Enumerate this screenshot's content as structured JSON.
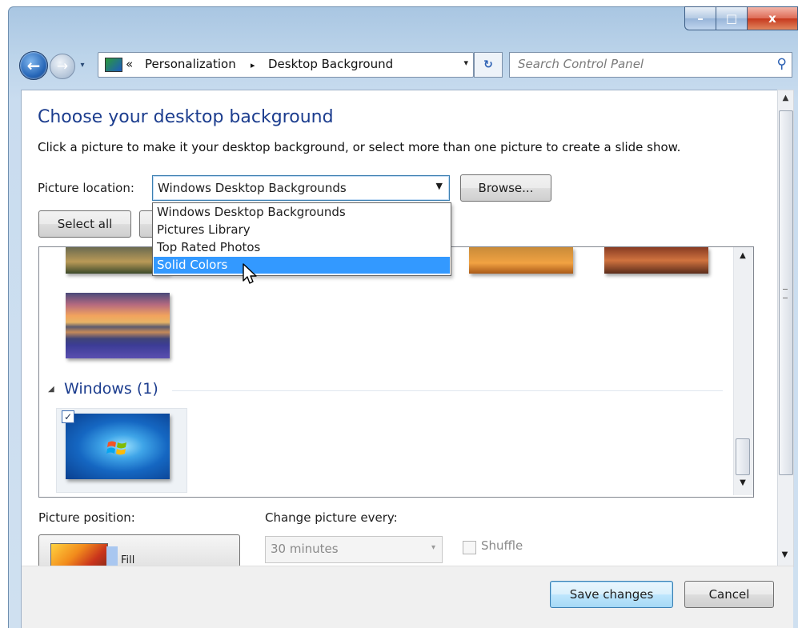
{
  "window": {
    "caption_buttons": {
      "minimize": "–",
      "maximize": "□",
      "close": "x"
    }
  },
  "nav": {
    "back_glyph": "←",
    "forward_glyph": "→",
    "history_glyph": "▾",
    "breadcrumb": {
      "overflow": "«",
      "items": [
        "Personalization",
        "Desktop Background"
      ],
      "separator": "▸"
    },
    "address_dropdown_glyph": "▾",
    "refresh_glyph": "↻",
    "search_placeholder": "Search Control Panel",
    "search_glyph": "⚲"
  },
  "page": {
    "title": "Choose your desktop background",
    "description": "Click a picture to make it your desktop background, or select more than one picture to create a slide show.",
    "picture_location_label": "Picture location:",
    "picture_location_value": "Windows Desktop Backgrounds",
    "browse_label": "Browse...",
    "select_all_label": "Select all"
  },
  "dropdown": {
    "options": [
      "Windows Desktop Backgrounds",
      "Pictures Library",
      "Top Rated Photos",
      "Solid Colors"
    ],
    "highlighted": "Solid Colors"
  },
  "picture_list": {
    "group_title": "Windows (1)",
    "group_glyph": "◢",
    "windows_thumbnail_checked": true,
    "check_glyph": "✓"
  },
  "options": {
    "picture_position_label": "Picture position:",
    "picture_position_value": "Fill",
    "change_every_label": "Change picture every:",
    "change_every_value": "30 minutes",
    "change_every_arrow": "▾",
    "shuffle_label": "Shuffle",
    "shuffle_checked": false
  },
  "footer": {
    "save_label": "Save changes",
    "cancel_label": "Cancel"
  },
  "scroll_glyphs": {
    "up": "▲",
    "down": "▼"
  },
  "colors": {
    "title_blue": "#1c3d8e",
    "selection_blue": "#3399ff"
  }
}
